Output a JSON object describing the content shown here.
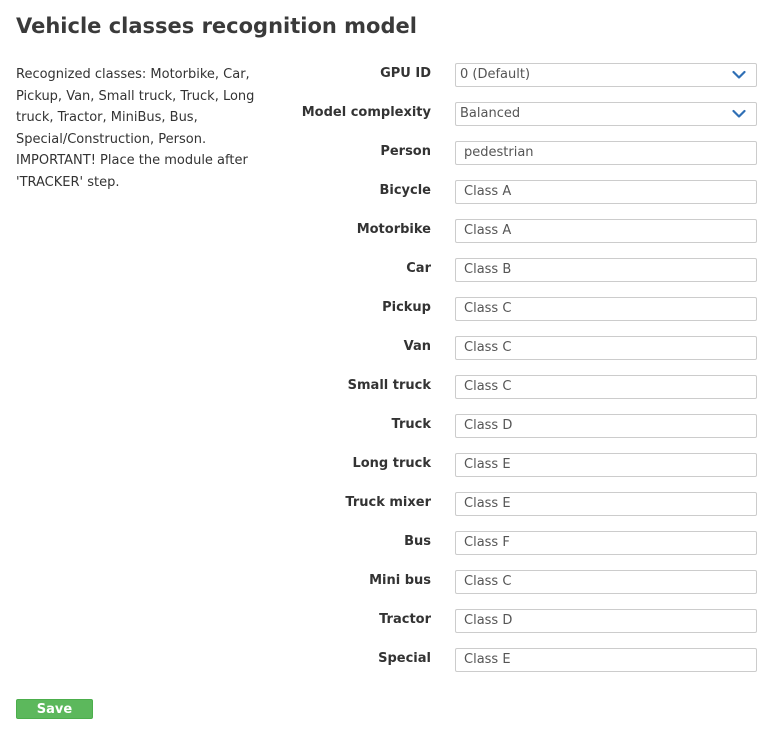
{
  "page": {
    "title": "Vehicle classes recognition model",
    "description": "Recognized classes: Motorbike, Car, Pickup, Van, Small truck, Truck, Long truck, Tractor, MiniBus, Bus, Special/Construction, Person. IMPORTANT! Place the module after 'TRACKER' step.",
    "save_label": "Save"
  },
  "fields": [
    {
      "label": "GPU ID",
      "type": "select",
      "value": "0 (Default)"
    },
    {
      "label": "Model complexity",
      "type": "select",
      "value": "Balanced"
    },
    {
      "label": "Person",
      "type": "text",
      "value": "pedestrian"
    },
    {
      "label": "Bicycle",
      "type": "text",
      "value": "Class A"
    },
    {
      "label": "Motorbike",
      "type": "text",
      "value": "Class A"
    },
    {
      "label": "Car",
      "type": "text",
      "value": "Class B"
    },
    {
      "label": "Pickup",
      "type": "text",
      "value": "Class C"
    },
    {
      "label": "Van",
      "type": "text",
      "value": "Class C"
    },
    {
      "label": "Small truck",
      "type": "text",
      "value": "Class C"
    },
    {
      "label": "Truck",
      "type": "text",
      "value": "Class D"
    },
    {
      "label": "Long truck",
      "type": "text",
      "value": "Class E"
    },
    {
      "label": "Truck mixer",
      "type": "text",
      "value": "Class E"
    },
    {
      "label": "Bus",
      "type": "text",
      "value": "Class F"
    },
    {
      "label": "Mini bus",
      "type": "text",
      "value": "Class C"
    },
    {
      "label": "Tractor",
      "type": "text",
      "value": "Class D"
    },
    {
      "label": "Special",
      "type": "text",
      "value": "Class E"
    }
  ],
  "colors": {
    "save_button": "#5cb85c",
    "chevron": "#2f6fb5"
  },
  "icons": {
    "select_arrow": "chevron-down-icon"
  }
}
